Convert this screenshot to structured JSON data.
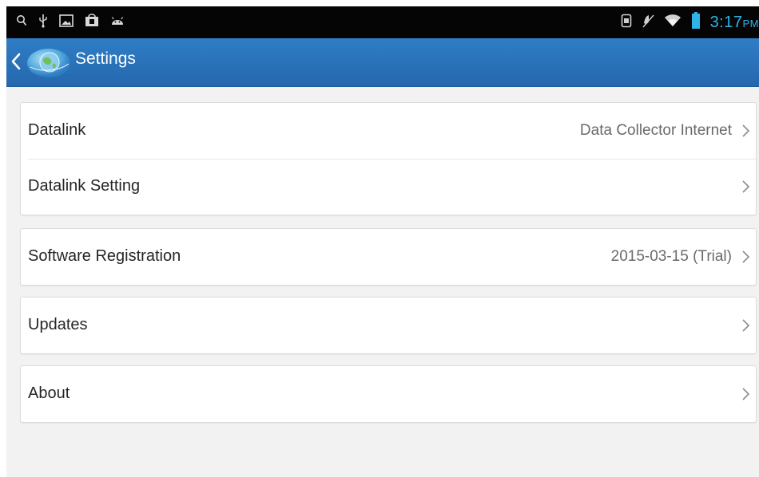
{
  "status_bar": {
    "left_icons": [
      "search-icon",
      "usb-icon",
      "image-icon",
      "store-icon",
      "android-icon"
    ],
    "right_icons": [
      "sim-icon",
      "mute-icon",
      "wifi-icon",
      "battery-icon"
    ],
    "time": "3:17",
    "ampm": "PM",
    "accent_color": "#2fb4ea"
  },
  "app_bar": {
    "title": "Settings",
    "back_icon": "chevron-left-icon",
    "logo_icon": "globe-logo-icon",
    "color": "#2a72b9"
  },
  "groups": [
    {
      "items": [
        {
          "label": "Datalink",
          "value": "Data Collector Internet"
        },
        {
          "label": "Datalink Setting",
          "value": ""
        }
      ]
    },
    {
      "items": [
        {
          "label": "Software Registration",
          "value": "2015-03-15 (Trial)"
        }
      ]
    },
    {
      "items": [
        {
          "label": "Updates",
          "value": ""
        }
      ]
    },
    {
      "items": [
        {
          "label": "About",
          "value": ""
        }
      ]
    }
  ]
}
